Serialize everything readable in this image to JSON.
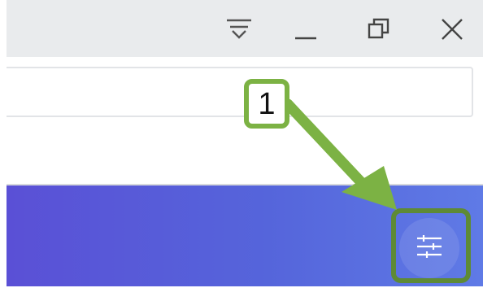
{
  "window_controls": {
    "dropdown_icon": "tab-list-dropdown-icon",
    "minimize_icon": "minimize-icon",
    "restore_icon": "restore-icon",
    "close_icon": "close-icon"
  },
  "address_bar": {
    "value": ""
  },
  "banner": {
    "gradient_start": "#5a50d6",
    "gradient_end": "#5f7ae6",
    "filter_button_icon": "sliders-icon"
  },
  "annotation": {
    "step_label": "1",
    "color": "#7cb244",
    "highlight_color": "#5e8a36"
  }
}
